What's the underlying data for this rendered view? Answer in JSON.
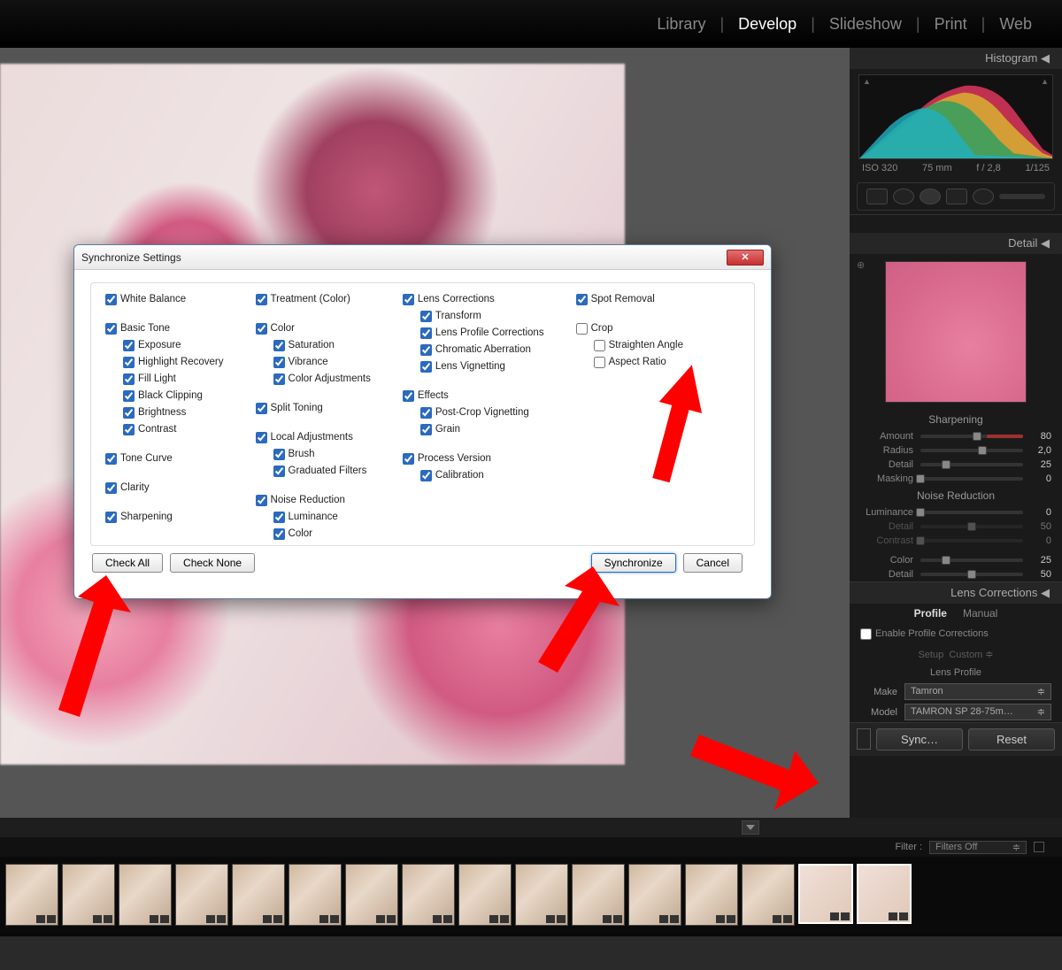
{
  "nav": {
    "library": "Library",
    "develop": "Develop",
    "slideshow": "Slideshow",
    "print": "Print",
    "web": "Web"
  },
  "histogram": {
    "title": "Histogram ◀",
    "iso": "ISO 320",
    "focal": "75 mm",
    "aperture": "f / 2,8",
    "shutter": "1/125"
  },
  "detail": {
    "title": "Detail ◀",
    "sharpening": {
      "title": "Sharpening",
      "amount": {
        "label": "Amount",
        "value": "80"
      },
      "radius": {
        "label": "Radius",
        "value": "2,0"
      },
      "detail": {
        "label": "Detail",
        "value": "25"
      },
      "masking": {
        "label": "Masking",
        "value": "0"
      }
    },
    "noise": {
      "title": "Noise Reduction",
      "luminance": {
        "label": "Luminance",
        "value": "0"
      },
      "detail": {
        "label": "Detail",
        "value": "50"
      },
      "contrast": {
        "label": "Contrast",
        "value": "0"
      },
      "color": {
        "label": "Color",
        "value": "25"
      },
      "cdetail": {
        "label": "Detail",
        "value": "50"
      }
    }
  },
  "lens": {
    "title": "Lens Corrections ◀",
    "profile": "Profile",
    "manual": "Manual",
    "enable": "Enable Profile Corrections",
    "setup": "Setup",
    "setup_val": "Custom ≑",
    "profile_label": "Lens Profile",
    "make": "Make",
    "make_val": "Tamron",
    "model": "Model",
    "model_val": "TAMRON SP 28-75m…"
  },
  "buttons": {
    "sync": "Sync…",
    "reset": "Reset"
  },
  "filter": {
    "label": "Filter :",
    "value": "Filters Off"
  },
  "dialog": {
    "title": "Synchronize Settings",
    "col1": {
      "wb": "White Balance",
      "basic": "Basic Tone",
      "exposure": "Exposure",
      "highlight": "Highlight Recovery",
      "fill": "Fill Light",
      "black": "Black Clipping",
      "bright": "Brightness",
      "contrast": "Contrast",
      "tcurve": "Tone Curve",
      "clarity": "Clarity",
      "sharp": "Sharpening"
    },
    "col2": {
      "treat": "Treatment (Color)",
      "color": "Color",
      "sat": "Saturation",
      "vib": "Vibrance",
      "cadj": "Color Adjustments",
      "split": "Split Toning",
      "local": "Local Adjustments",
      "brush": "Brush",
      "gfilt": "Graduated Filters",
      "noise": "Noise Reduction",
      "lum": "Luminance",
      "ncolor": "Color"
    },
    "col3": {
      "lens": "Lens Corrections",
      "trans": "Transform",
      "lpc": "Lens Profile Corrections",
      "chroma": "Chromatic Aberration",
      "lvig": "Lens Vignetting",
      "fx": "Effects",
      "pcv": "Post-Crop Vignetting",
      "grain": "Grain",
      "pver": "Process Version",
      "cal": "Calibration"
    },
    "col4": {
      "spot": "Spot Removal",
      "crop": "Crop",
      "straight": "Straighten Angle",
      "aspect": "Aspect Ratio"
    },
    "footer": {
      "checkall": "Check All",
      "checknone": "Check None",
      "sync": "Synchronize",
      "cancel": "Cancel"
    }
  }
}
